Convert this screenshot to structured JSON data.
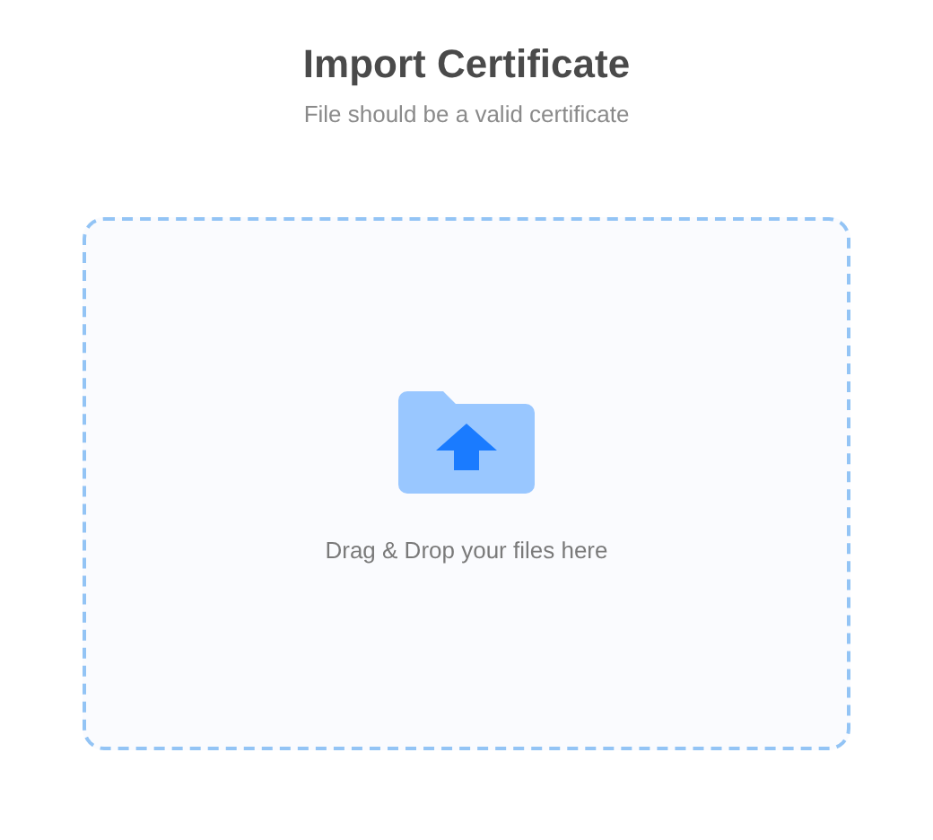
{
  "header": {
    "title": "Import Certificate",
    "subtitle": "File should be a valid certificate"
  },
  "dropzone": {
    "hint": "Drag & Drop your files here"
  }
}
